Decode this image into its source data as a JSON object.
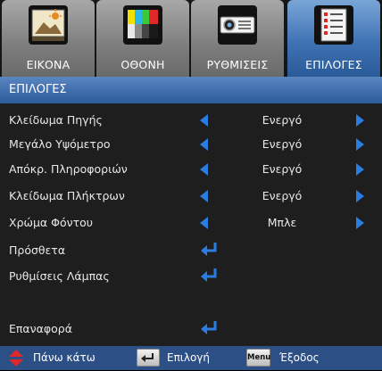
{
  "tabs": [
    {
      "label": "ΕΙΚΟΝΑ",
      "icon": "picture-icon",
      "active": false
    },
    {
      "label": "ΟΘΟΝΗ",
      "icon": "display-icon",
      "active": false
    },
    {
      "label": "ΡΥΘΜΙΣΕΙΣ",
      "icon": "projector-icon",
      "active": false
    },
    {
      "label": "ΕΠΙΛΟΓΕΣ",
      "icon": "checklist-icon",
      "active": true
    }
  ],
  "header": {
    "title": "ΕΠΙΛΟΓΕΣ"
  },
  "menu": {
    "items": [
      {
        "label": "Κλείδωμα Πηγής",
        "value": "Ενεργό"
      },
      {
        "label": "Μεγάλο Υψόμετρο",
        "value": "Ενεργό"
      },
      {
        "label": "Απόκρ. Πληροφοριών",
        "value": "Ενεργό"
      },
      {
        "label": "Κλείδωμα Πλήκτρων",
        "value": "Ενεργό"
      },
      {
        "label": "Χρώμα Φόντου",
        "value": "Μπλε"
      },
      {
        "label": "Πρόσθετα"
      },
      {
        "label": "Ρυθμίσεις Λάμπας"
      },
      {
        "label": "Επαναφορά"
      }
    ]
  },
  "footer": {
    "navigate_label": "Πάνω κάτω",
    "select_label": "Επιλογή",
    "menu_key_label": "Menu",
    "exit_label": "Έξοδος"
  },
  "colors": {
    "accent": "#2a7de0",
    "header": "#3c6aa8",
    "footer": "#2c4f86",
    "up_down_arrows": "#e0282c"
  }
}
